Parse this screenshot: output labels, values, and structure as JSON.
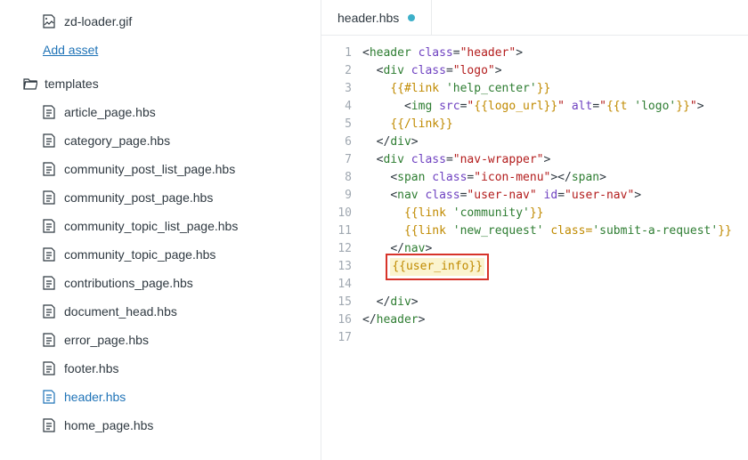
{
  "sidebar": {
    "asset_file": "zd-loader.gif",
    "add_asset_label": "Add asset",
    "folder_label": "templates",
    "files": [
      "article_page.hbs",
      "category_page.hbs",
      "community_post_list_page.hbs",
      "community_post_page.hbs",
      "community_topic_list_page.hbs",
      "community_topic_page.hbs",
      "contributions_page.hbs",
      "document_head.hbs",
      "error_page.hbs",
      "footer.hbs",
      "header.hbs",
      "home_page.hbs"
    ],
    "active_file": "header.hbs"
  },
  "tab": {
    "label": "header.hbs",
    "modified": true
  },
  "code": {
    "lines": 17,
    "highlighted_line": 13,
    "content": [
      {
        "indent": 0,
        "tokens": [
          {
            "t": "punct",
            "v": "<"
          },
          {
            "t": "tag",
            "v": "header"
          },
          {
            "t": "plain",
            "v": " "
          },
          {
            "t": "attr",
            "v": "class"
          },
          {
            "t": "punct",
            "v": "="
          },
          {
            "t": "str",
            "v": "\"header\""
          },
          {
            "t": "punct",
            "v": ">"
          }
        ]
      },
      {
        "indent": 1,
        "tokens": [
          {
            "t": "punct",
            "v": "<"
          },
          {
            "t": "tag",
            "v": "div"
          },
          {
            "t": "plain",
            "v": " "
          },
          {
            "t": "attr",
            "v": "class"
          },
          {
            "t": "punct",
            "v": "="
          },
          {
            "t": "str",
            "v": "\"logo\""
          },
          {
            "t": "punct",
            "v": ">"
          }
        ]
      },
      {
        "indent": 2,
        "tokens": [
          {
            "t": "hbs",
            "v": "{{#link "
          },
          {
            "t": "hbs-str",
            "v": "'help_center'"
          },
          {
            "t": "hbs",
            "v": "}}"
          }
        ]
      },
      {
        "indent": 3,
        "tokens": [
          {
            "t": "punct",
            "v": "<"
          },
          {
            "t": "tag",
            "v": "img"
          },
          {
            "t": "plain",
            "v": " "
          },
          {
            "t": "attr",
            "v": "src"
          },
          {
            "t": "punct",
            "v": "="
          },
          {
            "t": "str",
            "v": "\""
          },
          {
            "t": "hbs",
            "v": "{{logo_url}}"
          },
          {
            "t": "str",
            "v": "\""
          },
          {
            "t": "plain",
            "v": " "
          },
          {
            "t": "attr",
            "v": "alt"
          },
          {
            "t": "punct",
            "v": "="
          },
          {
            "t": "str",
            "v": "\""
          },
          {
            "t": "hbs",
            "v": "{{t "
          },
          {
            "t": "hbs-str",
            "v": "'logo'"
          },
          {
            "t": "hbs",
            "v": "}}"
          },
          {
            "t": "str",
            "v": "\""
          },
          {
            "t": "punct",
            "v": ">"
          }
        ]
      },
      {
        "indent": 2,
        "tokens": [
          {
            "t": "hbs",
            "v": "{{/link}}"
          }
        ]
      },
      {
        "indent": 1,
        "tokens": [
          {
            "t": "punct",
            "v": "</"
          },
          {
            "t": "tag",
            "v": "div"
          },
          {
            "t": "punct",
            "v": ">"
          }
        ]
      },
      {
        "indent": 1,
        "tokens": [
          {
            "t": "punct",
            "v": "<"
          },
          {
            "t": "tag",
            "v": "div"
          },
          {
            "t": "plain",
            "v": " "
          },
          {
            "t": "attr",
            "v": "class"
          },
          {
            "t": "punct",
            "v": "="
          },
          {
            "t": "str",
            "v": "\"nav-wrapper\""
          },
          {
            "t": "punct",
            "v": ">"
          }
        ]
      },
      {
        "indent": 2,
        "tokens": [
          {
            "t": "punct",
            "v": "<"
          },
          {
            "t": "tag",
            "v": "span"
          },
          {
            "t": "plain",
            "v": " "
          },
          {
            "t": "attr",
            "v": "class"
          },
          {
            "t": "punct",
            "v": "="
          },
          {
            "t": "str",
            "v": "\"icon-menu\""
          },
          {
            "t": "punct",
            "v": "></"
          },
          {
            "t": "tag",
            "v": "span"
          },
          {
            "t": "punct",
            "v": ">"
          }
        ]
      },
      {
        "indent": 2,
        "tokens": [
          {
            "t": "punct",
            "v": "<"
          },
          {
            "t": "tag",
            "v": "nav"
          },
          {
            "t": "plain",
            "v": " "
          },
          {
            "t": "attr",
            "v": "class"
          },
          {
            "t": "punct",
            "v": "="
          },
          {
            "t": "str",
            "v": "\"user-nav\""
          },
          {
            "t": "plain",
            "v": " "
          },
          {
            "t": "attr",
            "v": "id"
          },
          {
            "t": "punct",
            "v": "="
          },
          {
            "t": "str",
            "v": "\"user-nav\""
          },
          {
            "t": "punct",
            "v": ">"
          }
        ]
      },
      {
        "indent": 3,
        "tokens": [
          {
            "t": "hbs",
            "v": "{{link "
          },
          {
            "t": "hbs-str",
            "v": "'community'"
          },
          {
            "t": "hbs",
            "v": "}}"
          }
        ]
      },
      {
        "indent": 3,
        "tokens": [
          {
            "t": "hbs",
            "v": "{{link "
          },
          {
            "t": "hbs-str",
            "v": "'new_request'"
          },
          {
            "t": "hbs",
            "v": " class="
          },
          {
            "t": "hbs-str",
            "v": "'submit-a-request'"
          },
          {
            "t": "hbs",
            "v": "}}"
          }
        ]
      },
      {
        "indent": 2,
        "tokens": [
          {
            "t": "punct",
            "v": "</"
          },
          {
            "t": "tag",
            "v": "nav"
          },
          {
            "t": "punct",
            "v": ">"
          }
        ]
      },
      {
        "indent": 2,
        "highlight": true,
        "tokens": [
          {
            "t": "hbs",
            "v": "{{user_info}}"
          }
        ]
      },
      {
        "indent": 0,
        "tokens": []
      },
      {
        "indent": 1,
        "tokens": [
          {
            "t": "punct",
            "v": "</"
          },
          {
            "t": "tag",
            "v": "div"
          },
          {
            "t": "punct",
            "v": ">"
          }
        ]
      },
      {
        "indent": 0,
        "tokens": [
          {
            "t": "punct",
            "v": "</"
          },
          {
            "t": "tag",
            "v": "header"
          },
          {
            "t": "punct",
            "v": ">"
          }
        ]
      },
      {
        "indent": 0,
        "tokens": []
      }
    ]
  }
}
